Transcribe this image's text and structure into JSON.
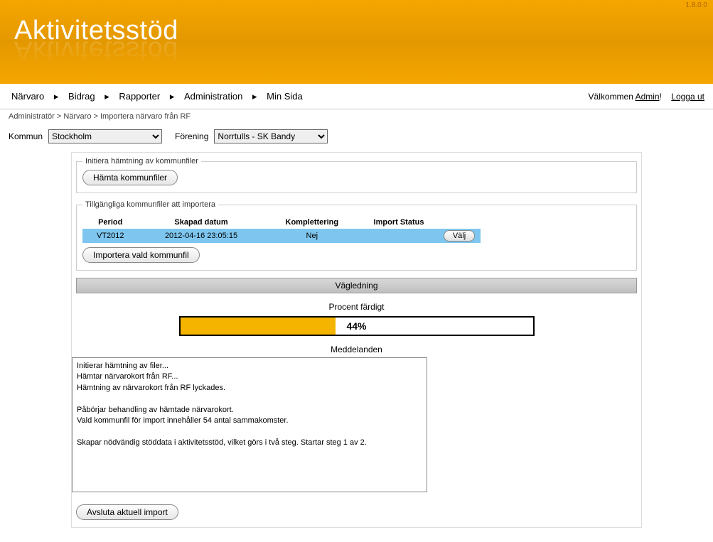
{
  "version": "1.8.0.0",
  "logo": "Aktivitetsstöd",
  "nav": {
    "items": [
      "Närvaro",
      "Bidrag",
      "Rapporter",
      "Administration",
      "Min Sida"
    ],
    "welcome_prefix": "Välkommen ",
    "user": "Admin",
    "welcome_suffix": "!",
    "logout": "Logga ut"
  },
  "breadcrumb": "Administratör > Närvaro > Importera närvaro från RF",
  "filters": {
    "kommun_label": "Kommun",
    "kommun_value": "Stockholm",
    "forening_label": "Förening",
    "forening_value": "Norrtulls - SK Bandy"
  },
  "panel1": {
    "legend": "Initiera hämtning av kommunfiler",
    "fetch_btn": "Hämta kommunfiler"
  },
  "panel2": {
    "legend": "Tillgängliga kommunfiler att importera",
    "headers": {
      "period": "Period",
      "created": "Skapad datum",
      "completion": "Komplettering",
      "status": "Import Status"
    },
    "row": {
      "period": "VT2012",
      "created": "2012-04-16 23:05:15",
      "completion": "Nej",
      "select_btn": "Välj"
    },
    "import_btn": "Importera vald kommunfil"
  },
  "guidance": "Vägledning",
  "progress": {
    "label": "Procent färdigt",
    "percent": 44,
    "text": "44%"
  },
  "messages": {
    "label": "Meddelanden",
    "body": "Initierar hämtning av filer...\nHämtar närvarokort från RF...\nHämtning av närvarokort från RF lyckades.\n\nPåbörjar behandling av hämtade närvarokort.\nVald kommunfil för import innehåller 54 antal sammakomster.\n\nSkapar nödvändig stöddata i aktivitetsstöd, vilket görs i två steg. Startar steg 1 av 2."
  },
  "abort_btn": "Avsluta aktuell import"
}
